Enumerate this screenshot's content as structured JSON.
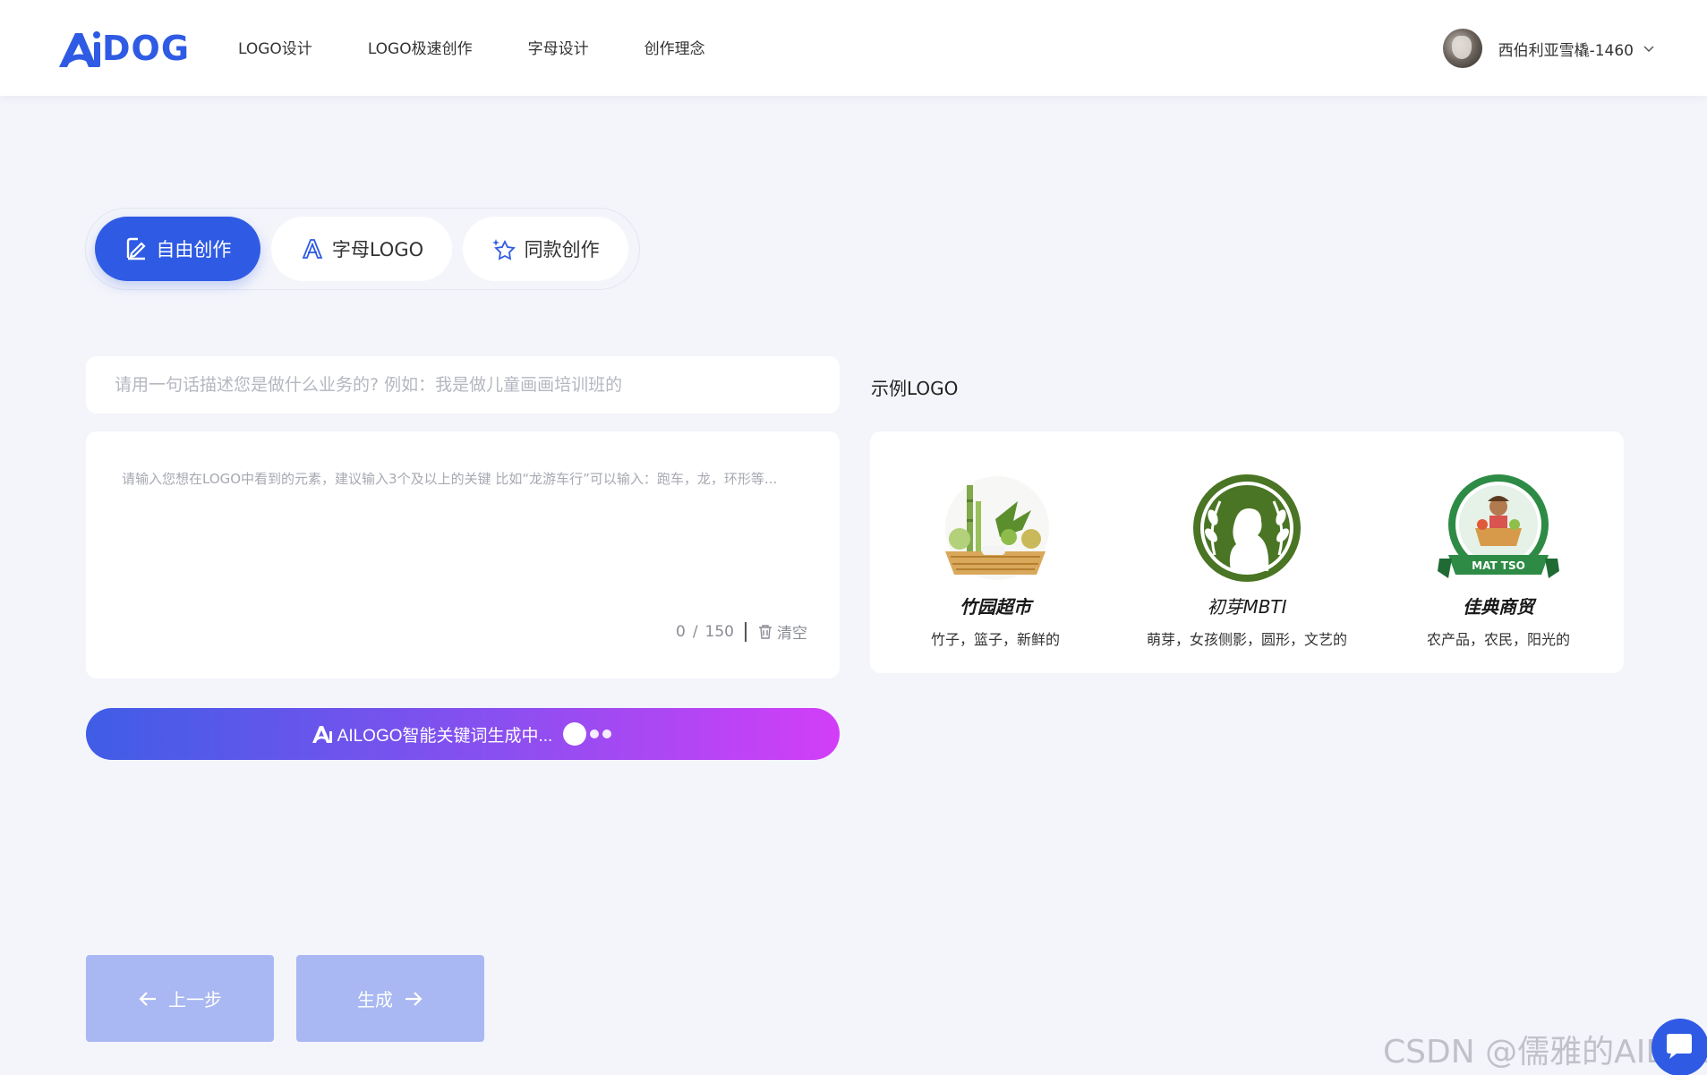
{
  "header": {
    "logo_text": "DOG",
    "nav": [
      "LOGO设计",
      "LOGO极速创作",
      "字母设计",
      "创作理念"
    ],
    "user_name": "西伯利亚雪橇-1460"
  },
  "modes": {
    "free": "自由创作",
    "letter": "字母LOGO",
    "same": "同款创作"
  },
  "form": {
    "desc_placeholder": "请用一句话描述您是做什么业务的? 例如：我是做儿童画画培训班的",
    "kw_placeholder": "请输入您想在LOGO中看到的元素，建议输入3个及以上的关键 比如“龙游车行”可以输入：跑车，龙，环形等...",
    "count_current": "0",
    "count_sep": "/",
    "count_max": "150",
    "clear_label": "清空",
    "generating_label": "AILOGO智能关键词生成中..."
  },
  "examples": {
    "title": "示例LOGO",
    "items": [
      {
        "name": "竹园超市",
        "keywords": "竹子，篮子，新鲜的"
      },
      {
        "name": "初芽MBTI",
        "keywords": "萌芽，女孩侧影，圆形，文艺的"
      },
      {
        "name": "佳典商贸",
        "keywords": "农产品，农民，阳光的",
        "badge": "MAT TSO"
      }
    ]
  },
  "footer": {
    "prev_label": "上一步",
    "next_label": "生成",
    "watermark": "CSDN @儒雅的AIDOG"
  },
  "colors": {
    "brand": "#2f5be4",
    "disabled_button": "#a9b8f2",
    "gradient_start": "#3f5de6",
    "gradient_end": "#d33ef8"
  }
}
